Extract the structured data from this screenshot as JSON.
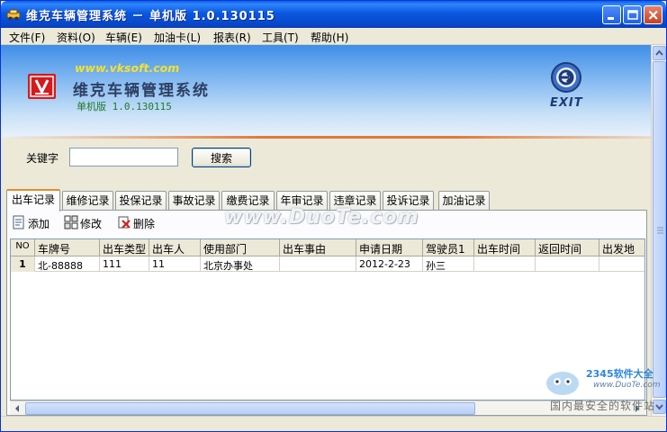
{
  "window": {
    "title": "维克车辆管理系统 － 单机版 1.0.130115",
    "icon": "car-app-icon"
  },
  "menu": [
    {
      "label": "文件(F)"
    },
    {
      "label": "资料(O)"
    },
    {
      "label": "车辆(E)"
    },
    {
      "label": "加油卡(L)"
    },
    {
      "label": "报表(R)"
    },
    {
      "label": "工具(T)"
    },
    {
      "label": "帮助(H)"
    }
  ],
  "banner": {
    "url": "www.vksoft.com",
    "app_name": "维克车辆管理系统",
    "version": "单机版 1.0.130115",
    "exit_label": "EXIT"
  },
  "search": {
    "label": "关键字",
    "value": "",
    "button_label": "搜索"
  },
  "tabs": [
    {
      "label": "出车记录",
      "active": true
    },
    {
      "label": "维修记录"
    },
    {
      "label": "投保记录"
    },
    {
      "label": "事故记录"
    },
    {
      "label": "缴费记录"
    },
    {
      "label": "年审记录"
    },
    {
      "label": "违章记录"
    },
    {
      "label": "投诉记录"
    },
    {
      "label": "加油记录"
    }
  ],
  "toolbar": {
    "add_label": "添加",
    "edit_label": "修改",
    "delete_label": "删除"
  },
  "grid": {
    "columns": [
      "NO",
      "车牌号",
      "出车类型",
      "出车人",
      "使用部门",
      "出车事由",
      "申请日期",
      "驾驶员1",
      "出车时间",
      "返回时间",
      "出发地"
    ],
    "rows": [
      [
        "1",
        "北-88888",
        "111",
        "11",
        "北京办事处",
        "",
        "2012-2-23",
        "孙三",
        "",
        "",
        ""
      ]
    ]
  },
  "watermarks": {
    "center": "www.DuoTe.com",
    "corner_brand": "2345软件大全",
    "corner_url": "www.DuoTe.com",
    "corner_slogan": "国内最安全的软件站"
  },
  "colors": {
    "titlebar": "#0a58e0",
    "tab_active_accent": "#e68b2c",
    "logo_red": "#d7191c",
    "url_yellow": "#f3e22c",
    "version_green": "#1f7a2b"
  }
}
